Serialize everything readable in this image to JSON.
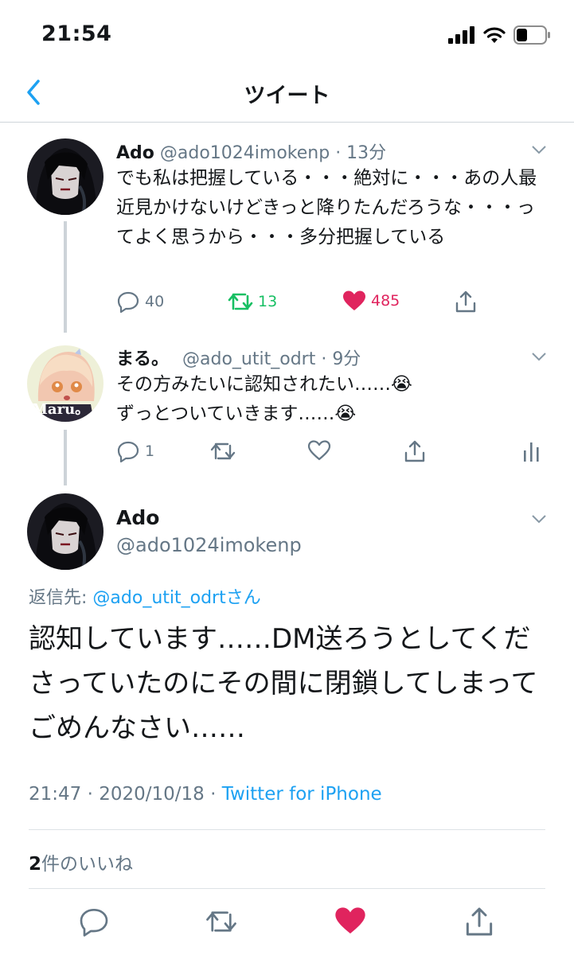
{
  "status_bar": {
    "time": "21:54"
  },
  "nav": {
    "title": "ツイート"
  },
  "tweets": [
    {
      "name": "Ado",
      "handle": "@ado1024imokenp",
      "time": "· 13分",
      "text": "でも私は把握している・・・絶対に・・・あの人最近見かけないけどきっと降りたんだろうな・・・ってよく思うから・・・多分把握している",
      "replies": "40",
      "retweets": "13",
      "likes": "485"
    },
    {
      "name": "まる。",
      "handle": "@ado_utit_odrt",
      "time": "· 9分",
      "line1": "その方みたいに認知されたい……",
      "line2": "ずっとついていきます……",
      "emoji": "😭",
      "replies": "1",
      "avatar_text": "Maru。"
    }
  ],
  "main_tweet": {
    "name": "Ado",
    "handle": "@ado1024imokenp",
    "reply_prefix": "返信先: ",
    "reply_target": "@ado_utit_odrtさん",
    "text": "認知しています……DM送ろうとしてくださっていたのにその間に閉鎖してしまってごめんなさい……",
    "timestamp": "21:47 · 2020/10/18 · ",
    "source": "Twitter for iPhone",
    "like_count": "2",
    "like_label": "件のいいね"
  },
  "colors": {
    "accent": "#1da1f2",
    "retweet": "#17bf63",
    "like": "#e0245e",
    "muted": "#657786"
  }
}
